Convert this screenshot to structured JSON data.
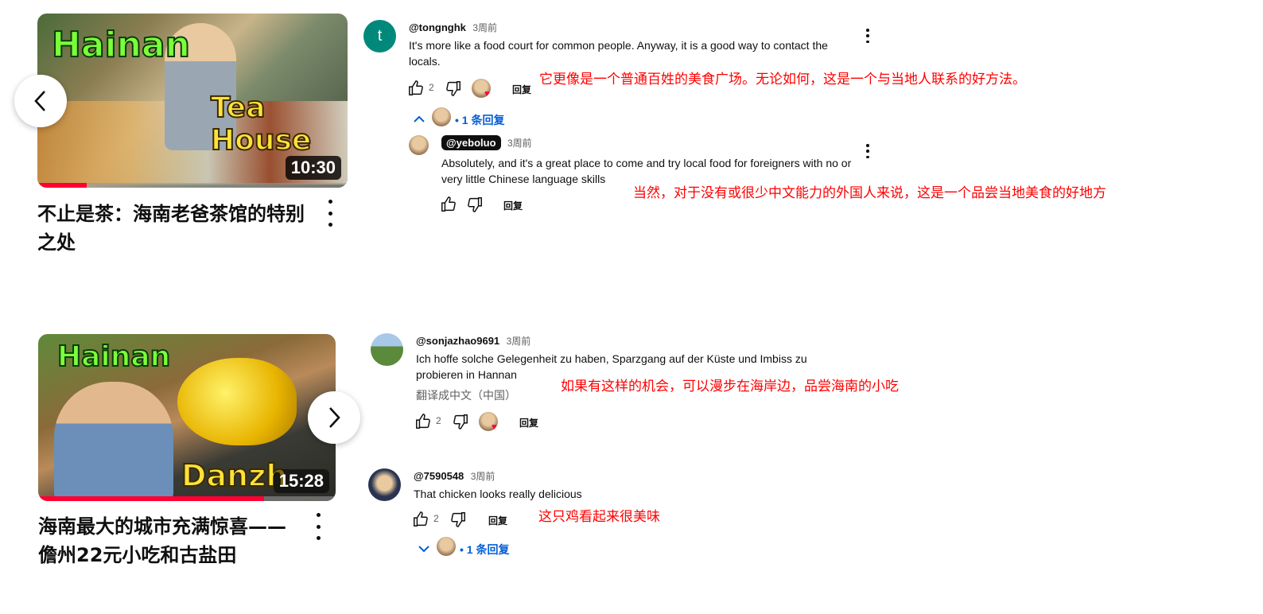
{
  "videos": [
    {
      "thumb_words": [
        "Hainan",
        "Tea House"
      ],
      "duration": "10:30",
      "progress": 0.16,
      "title": "不止是茶：海南老爸茶馆的特别之处"
    },
    {
      "thumb_words": [
        "Hainan",
        "Danzh"
      ],
      "duration": "15:28",
      "progress": 0.76,
      "title": "海南最大的城市充满惊喜——儋州22元小吃和古盐田"
    }
  ],
  "comments": [
    {
      "avatar_letter": "t",
      "author": "@tongnghk",
      "time": "3周前",
      "text": "It's more like a food court for common people. Anyway, it is a good way to contact the locals.",
      "likes": "2",
      "reply_label": "回复",
      "annotation": "它更像是一个普通百姓的美食广场。无论如何，这是一个与当地人联系的好方法。",
      "replies_link": "• 1 条回复",
      "reply": {
        "author": "@yeboluo",
        "time": "3周前",
        "text": "Absolutely, and it's a great place to come and try local food for foreigners with no or very little Chinese language skills",
        "reply_label": "回复",
        "annotation": "当然，对于没有或很少中文能力的外国人来说，这是一个品尝当地美食的好地方"
      }
    },
    {
      "author": "@sonjazhao9691",
      "time": "3周前",
      "text": "Ich hoffe solche Gelegenheit zu haben, Sparzgang auf der Küste und Imbiss zu probieren in Hannan",
      "translate_label": "翻译成中文（中国）",
      "likes": "2",
      "reply_label": "回复",
      "annotation": "如果有这样的机会，可以漫步在海岸边，品尝海南的小吃"
    },
    {
      "author": "@7590548",
      "time": "3周前",
      "text": "That chicken looks really delicious",
      "likes": "2",
      "reply_label": "回复",
      "annotation": "这只鸡看起来很美味",
      "replies_link": "• 1 条回复"
    }
  ],
  "colors": {
    "accent": "#065fd4",
    "progress": "#ff0033",
    "annotation": "#ff0000",
    "avatar_t": "#00897b"
  },
  "icons": [
    "chevron-left-icon",
    "chevron-right-icon",
    "thumb-up-icon",
    "thumb-down-icon",
    "chevron-up-icon",
    "chevron-down-icon",
    "more-vert-icon",
    "heart-icon"
  ]
}
